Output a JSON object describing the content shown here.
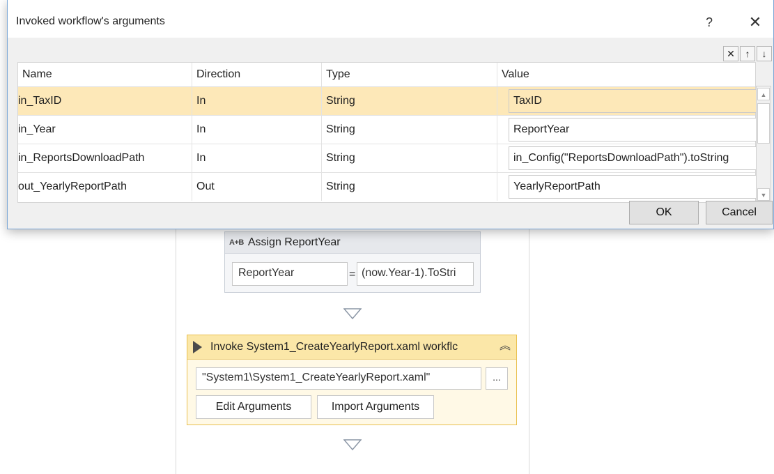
{
  "dialog": {
    "title": "Invoked workflow's arguments",
    "help_glyph": "?",
    "close_glyph": "✕",
    "toolbar": {
      "delete_glyph": "✕",
      "up_glyph": "↑",
      "down_glyph": "↓"
    },
    "columns": [
      "Name",
      "Direction",
      "Type",
      "Value"
    ],
    "rows": [
      {
        "name": "in_TaxID",
        "direction": "In",
        "type": "String",
        "value": "TaxID"
      },
      {
        "name": "in_Year",
        "direction": "In",
        "type": "String",
        "value": "ReportYear"
      },
      {
        "name": "in_ReportsDownloadPath",
        "direction": "In",
        "type": "String",
        "value": "in_Config(\"ReportsDownloadPath\").toString"
      },
      {
        "name": "out_YearlyReportPath",
        "direction": "Out",
        "type": "String",
        "value": "YearlyReportPath"
      }
    ],
    "ok_label": "OK",
    "cancel_label": "Cancel"
  },
  "designer": {
    "assign": {
      "icon": "A+B",
      "title": "Assign ReportYear",
      "to": "ReportYear",
      "eq": "=",
      "value": "(now.Year-1).ToStri"
    },
    "invoke": {
      "title": "Invoke System1_CreateYearlyReport.xaml workflc",
      "path": "\"System1\\System1_CreateYearlyReport.xaml\"",
      "browse": "...",
      "edit_label": "Edit Arguments",
      "import_label": "Import Arguments"
    }
  },
  "colors": {
    "selected_row": "#fde8b8",
    "invoke_accent": "#e9c04f",
    "dialog_border": "#7aa6d6"
  }
}
